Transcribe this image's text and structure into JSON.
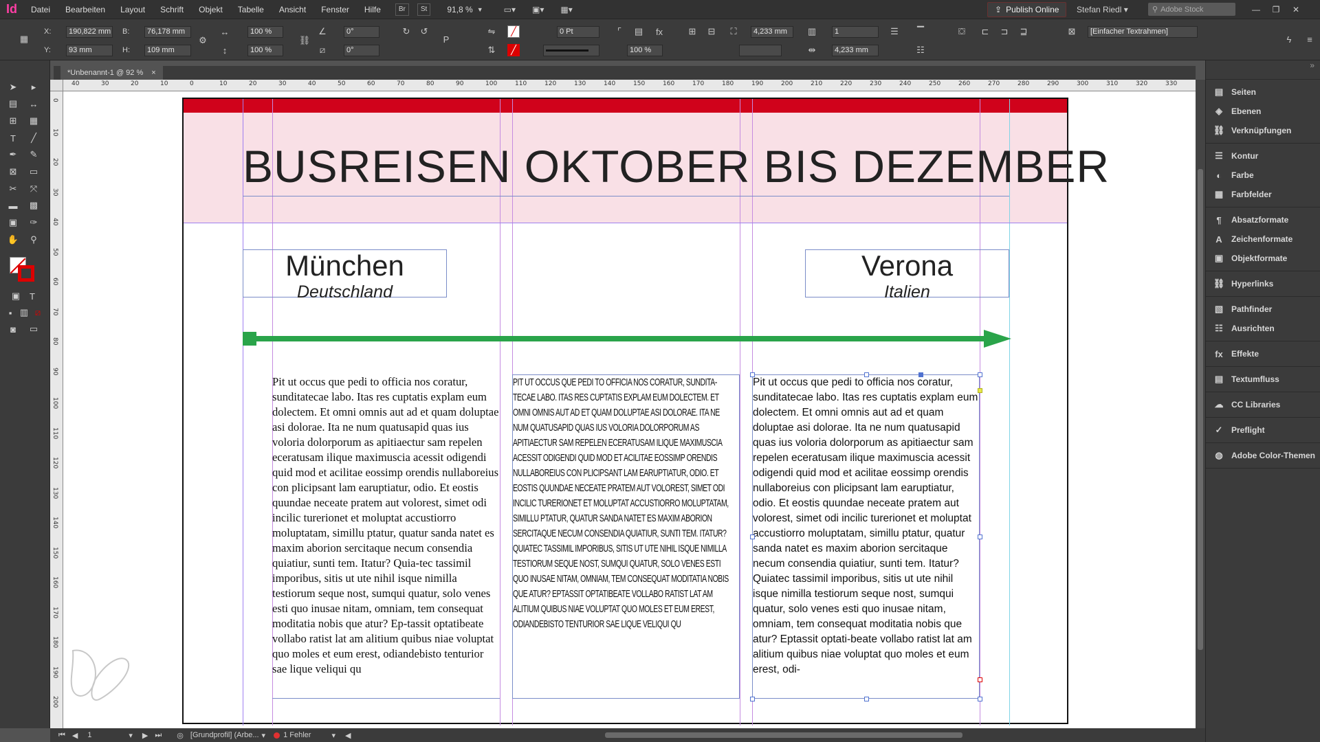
{
  "app": {
    "logo": "Id",
    "menus": [
      "Datei",
      "Bearbeiten",
      "Layout",
      "Schrift",
      "Objekt",
      "Tabelle",
      "Ansicht",
      "Fenster",
      "Hilfe"
    ],
    "bridge_label": "Br",
    "stock_label": "St",
    "zoom": "91,8 %",
    "publish_label": "Publish Online",
    "user": "Stefan Riedl",
    "search_placeholder": "Adobe Stock"
  },
  "control": {
    "x_label": "X:",
    "x": "190,822 mm",
    "y_label": "Y:",
    "y": "93 mm",
    "w_label": "B:",
    "w": "76,178 mm",
    "h_label": "H:",
    "h": "109 mm",
    "scale_x": "100 %",
    "scale_y": "100 %",
    "angle": "0°",
    "shear": "0°",
    "stroke": "0 Pt",
    "opacity": "100 %",
    "gutter": "4,233 mm",
    "columns": "1",
    "col_gutter": "4,233 mm",
    "frame_style": "[Einfacher Textrahmen]"
  },
  "tab": {
    "title": "*Unbenannt-1 @ 92 %",
    "close": "×"
  },
  "ruler": {
    "h_ticks": [
      "40",
      "30",
      "20",
      "10",
      "0",
      "10",
      "20",
      "30",
      "40",
      "50",
      "60",
      "70",
      "80",
      "90",
      "100",
      "110",
      "120",
      "130",
      "140",
      "150",
      "160",
      "170",
      "180",
      "190",
      "200",
      "210",
      "220",
      "230",
      "240",
      "250",
      "260",
      "270",
      "280",
      "290",
      "300",
      "310",
      "320",
      "330"
    ],
    "v_ticks": [
      "0",
      "10",
      "20",
      "30",
      "40",
      "50",
      "60",
      "70",
      "80",
      "90",
      "100",
      "110",
      "120",
      "130",
      "140",
      "150",
      "160",
      "170",
      "180",
      "190",
      "200"
    ]
  },
  "document": {
    "title": "BUSREISEN OKTOBER BIS DEZEMBER",
    "origin": {
      "city": "München",
      "country": "Deutschland"
    },
    "destination": {
      "city": "Verona",
      "country": "Italien"
    },
    "colors": {
      "red_bar": "#d0021b",
      "header_bg": "#f9e0e6",
      "route": "#2aa44a"
    },
    "col1_text": "Pit ut occus que pedi to officia nos coratur, sunditatecae labo. Itas res cuptatis explam eum dolectem. Et omni omnis aut ad et quam doluptae asi dolorae. Ita ne num quatusapid quas ius voloria dolorporum as apitiaectur sam repelen eceratusam ilique maximuscia acessit odigendi quid mod et acilitae eossimp orendis nullaboreius con plicipsant lam earuptiatur, odio. Et eostis quundae neceate pratem aut volorest, simet odi incilic turerionet et moluptat accustiorro moluptatam, simillu ptatur, quatur sanda natet es maxim aborion sercitaque necum consendia quiatiur, sunti tem. Itatur? Quia-tec tassimil imporibus, sitis ut ute nihil isque nimilla testiorum seque nost, sumqui quatur, solo venes esti quo inusae nitam, omniam, tem consequat moditatia nobis que atur? Ep-tassit optatibeate vollabo ratist lat am alitium quibus niae voluptat quo moles et eum erest, odiandebisto tenturior sae lique veliqui qu",
    "col2_text": "Pit ut occus que pedi to officia nos coratur, sundita-tecae labo. Itas res cuptatis explam eum dolectem. Et omni omnis aut ad et quam doluptae asi dolorae. Ita ne num quatusapid quas ius voloria dolorporum as apitiaectur sam repelen eceratusam ilique maximuscia acessit odigendi quid mod et acilitae eossimp orendis nullaboreius con plicipsant lam earuptiatur, odio. Et eostis quundae neceate pratem aut volorest, simet odi incilic turerionet et moluptat accustiorro moluptatam, simillu ptatur, quatur sanda natet es maxim aborion sercitaque necum consendia quiatiur, sunti tem. Itatur? Quiatec tassimil imporibus, sitis ut ute nihil isque nimilla testiorum seque nost, sumqui quatur, solo venes esti quo inusae nitam, omniam, tem consequat moditatia nobis que atur? Eptassit optatibeate vollabo ratist lat am alitium quibus niae voluptat quo moles et eum erest, odiandebisto tenturior sae lique veliqui qu",
    "col3_text": "Pit ut occus que pedi to officia nos coratur, sunditatecae labo. Itas res cuptatis explam eum dolectem. Et omni omnis aut ad et quam doluptae asi dolorae. Ita ne num quatusapid quas ius voloria dolorporum as apitiaectur sam repelen eceratusam ilique maximuscia acessit odigendi quid mod et acilitae eossimp orendis nullaboreius con plicipsant lam earuptiatur, odio. Et eostis quundae neceate pratem aut volorest, simet odi incilic turerionet et moluptat accustiorro moluptatam, simillu ptatur, quatur sanda natet es maxim aborion sercitaque necum consendia quiatiur, sunti tem. Itatur? Quiatec tassimil imporibus, sitis ut ute nihil isque nimilla testiorum seque nost, sumqui quatur, solo venes esti quo inusae nitam, omniam, tem consequat moditatia nobis que atur? Eptassit optati-beate vollabo ratist lat am alitium quibus niae voluptat quo moles et eum erest, odi-"
  },
  "status": {
    "page": "1",
    "profile": "[Grundprofil] (Arbe...",
    "errors": "1 Fehler"
  },
  "panels": [
    {
      "label": "Seiten",
      "icon": "pages-icon"
    },
    {
      "label": "Ebenen",
      "icon": "layers-icon"
    },
    {
      "label": "Verknüpfungen",
      "icon": "links-icon"
    },
    {
      "label": "Kontur",
      "icon": "stroke-icon"
    },
    {
      "label": "Farbe",
      "icon": "color-icon"
    },
    {
      "label": "Farbfelder",
      "icon": "swatches-icon"
    },
    {
      "label": "Absatzformate",
      "icon": "paragraph-styles-icon"
    },
    {
      "label": "Zeichenformate",
      "icon": "character-styles-icon"
    },
    {
      "label": "Objektformate",
      "icon": "object-styles-icon"
    },
    {
      "label": "Hyperlinks",
      "icon": "hyperlinks-icon"
    },
    {
      "label": "Pathfinder",
      "icon": "pathfinder-icon"
    },
    {
      "label": "Ausrichten",
      "icon": "align-icon"
    },
    {
      "label": "Effekte",
      "icon": "effects-icon"
    },
    {
      "label": "Textumfluss",
      "icon": "text-wrap-icon"
    },
    {
      "label": "CC Libraries",
      "icon": "cc-libraries-icon"
    },
    {
      "label": "Preflight",
      "icon": "preflight-icon"
    },
    {
      "label": "Adobe Color-Themen",
      "icon": "color-themes-icon"
    }
  ]
}
